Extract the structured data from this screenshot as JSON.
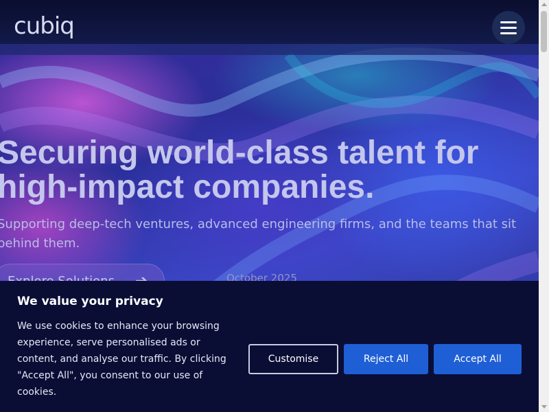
{
  "header": {
    "logo": "cubiq",
    "menu_icon": "hamburger-menu-icon"
  },
  "hero": {
    "headline": "Securing world-class talent for high-impact companies.",
    "subtitle": "Supporting deep-tech ventures, advanced engineering firms, and the teams that sit behind them.",
    "cta_label": "Explore Solutions",
    "cta_icon": "arrow-right-icon",
    "date": "October 2025"
  },
  "cookie_banner": {
    "title": "We value your privacy",
    "text": "We use cookies to enhance your browsing experience, serve personalised ads or content, and analyse our traffic. By clicking \"Accept All\", you consent to our use of cookies.",
    "customise_label": "Customise",
    "reject_label": "Reject All",
    "accept_label": "Accept All"
  },
  "colors": {
    "banner_bg": "#0a0e35",
    "button_blue": "#1f5fd6",
    "headline": "#c4c6ec"
  }
}
